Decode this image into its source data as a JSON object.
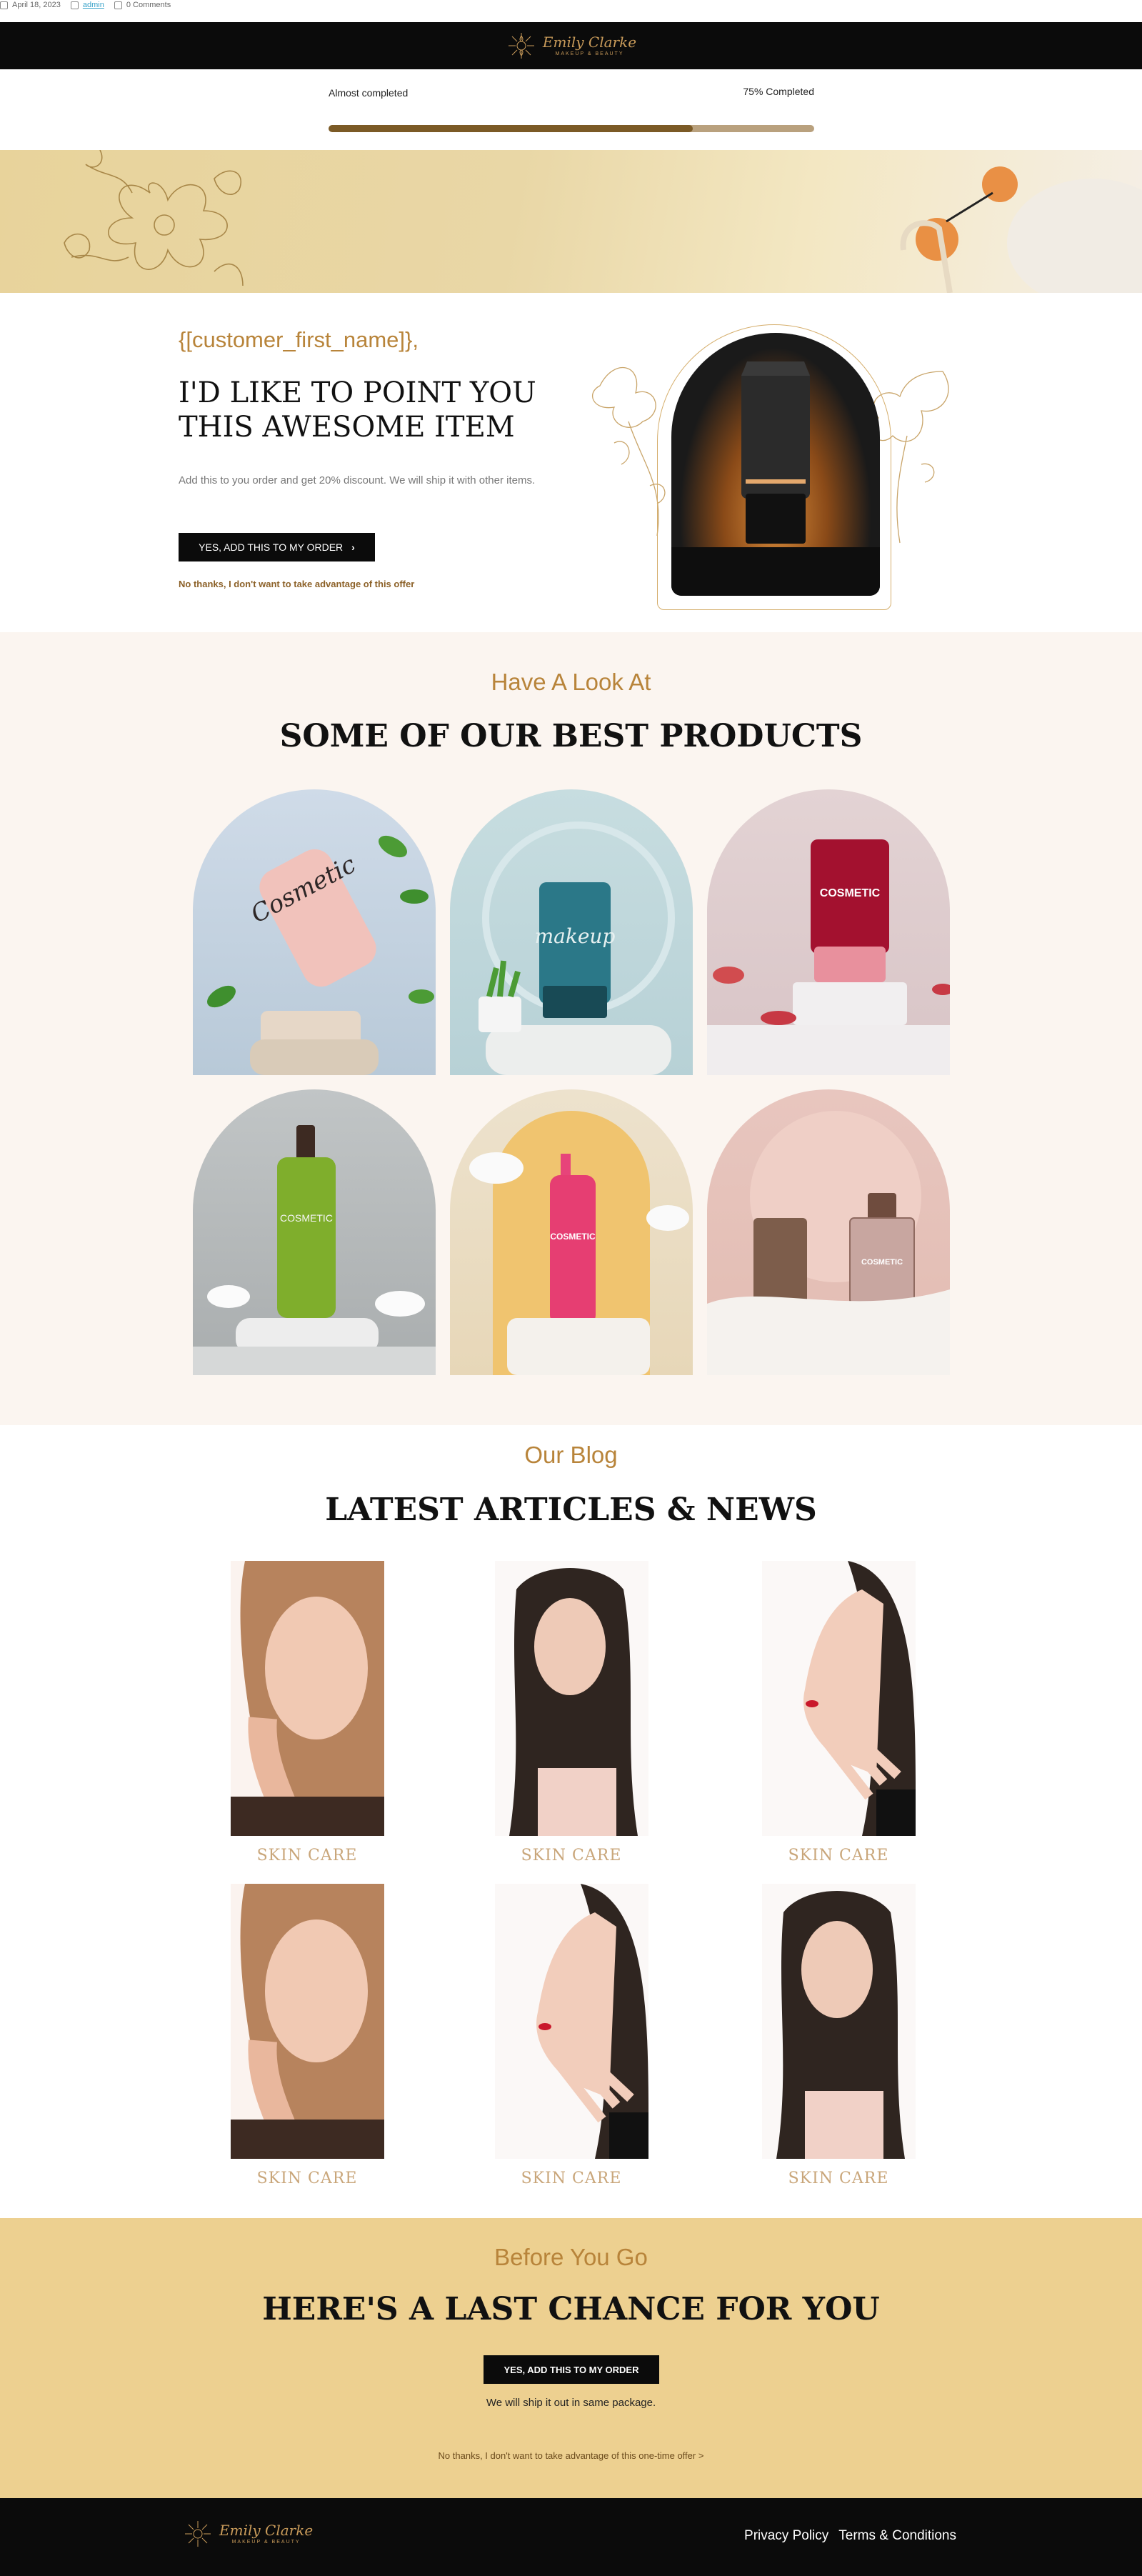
{
  "meta": {
    "date": "April 18, 2023",
    "author": "admin",
    "comments": "0 Comments"
  },
  "brand": {
    "name": "Emily Clarke",
    "tagline": "MAKEUP & BEAUTY"
  },
  "progress": {
    "label_left": "Almost completed",
    "label_right": "75% Completed",
    "value": 0.75
  },
  "offer": {
    "greeting": "{[customer_first_name]},",
    "headline": "I'D LIKE TO POINT YOU THIS AWESOME ITEM",
    "description": "Add this to you order and get 20% discount. We will ship it with other items.",
    "button_label": "YES, ADD THIS TO MY ORDER",
    "decline_label": "No thanks, I don't want to take advantage of this offer"
  },
  "products": {
    "subtitle": "Have A Look At",
    "title": "SOME OF OUR BEST PRODUCTS",
    "items": [
      {
        "label": "Cosmetic"
      },
      {
        "label": "makeup"
      },
      {
        "label": "COSMETIC"
      },
      {
        "label": "COSMETIC"
      },
      {
        "label": "COSMETIC"
      },
      {
        "label": "COSMETIC"
      }
    ]
  },
  "blog": {
    "subtitle": "Our Blog",
    "title": "LATEST ARTICLES & NEWS",
    "posts": [
      {
        "category": "SKIN CARE"
      },
      {
        "category": "SKIN CARE"
      },
      {
        "category": "SKIN CARE"
      },
      {
        "category": "SKIN CARE"
      },
      {
        "category": "SKIN CARE"
      },
      {
        "category": "SKIN CARE"
      }
    ]
  },
  "last_chance": {
    "subtitle": "Before You Go",
    "title": "HERE'S A LAST CHANCE FOR YOU",
    "button_label": "YES, ADD THIS TO MY ORDER",
    "note": "We will ship it out in same package.",
    "decline_label": "No thanks, I don't want to take advantage of this one-time offer >"
  },
  "footer": {
    "links": [
      "Privacy Policy",
      "Terms & Conditions"
    ]
  },
  "colors": {
    "gold": "#b8843a",
    "dark": "#0b0b0b",
    "cream": "#fbf5f0",
    "sand": "#edd090"
  }
}
